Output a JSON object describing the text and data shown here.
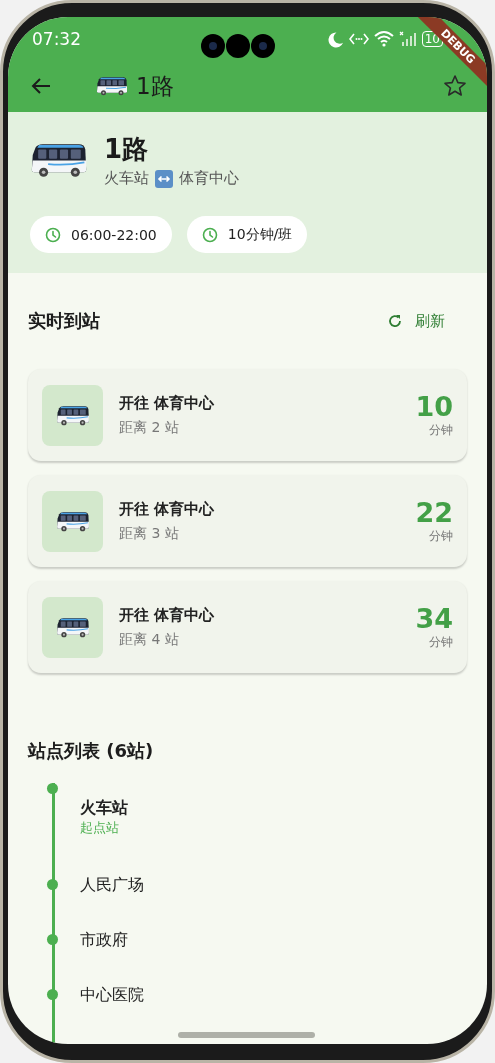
{
  "status_bar": {
    "time": "07:32",
    "battery": "10"
  },
  "debug_banner": "DEBUG",
  "app_bar": {
    "title": "1路",
    "favorite": false
  },
  "route": {
    "name": "1路",
    "from": "火车站",
    "to": "体育中心",
    "chips": [
      {
        "text": "06:00-22:00"
      },
      {
        "text": "10分钟/班"
      }
    ]
  },
  "realtime": {
    "title": "实时到站",
    "refresh": "刷新",
    "arrivals": [
      {
        "destination": "开往 体育中心",
        "distance": "距离 2 站",
        "minutes": "10",
        "unit": "分钟"
      },
      {
        "destination": "开往 体育中心",
        "distance": "距离 3 站",
        "minutes": "22",
        "unit": "分钟"
      },
      {
        "destination": "开往 体育中心",
        "distance": "距离 4 站",
        "minutes": "34",
        "unit": "分钟"
      }
    ]
  },
  "stops": {
    "title": "站点列表 (6站)",
    "items": [
      {
        "name": "火车站",
        "tag": "起点站"
      },
      {
        "name": "人民广场"
      },
      {
        "name": "市政府"
      },
      {
        "name": "中心医院"
      }
    ]
  }
}
